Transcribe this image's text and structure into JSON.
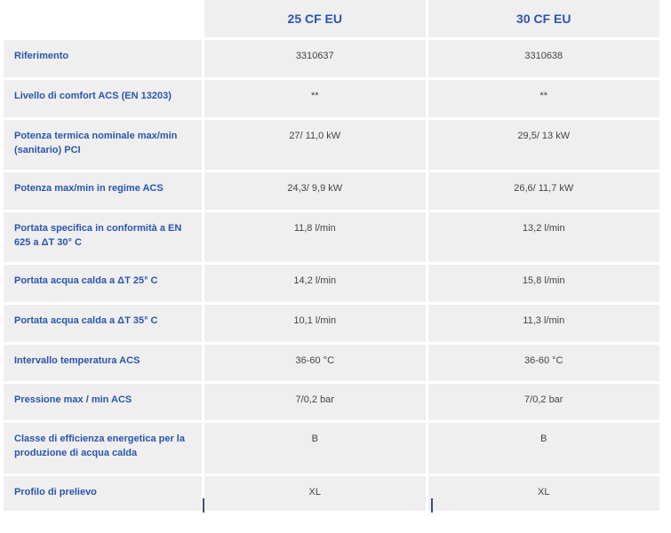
{
  "table": {
    "columns": [
      "25 CF EU",
      "30 CF EU"
    ],
    "rows": [
      {
        "label": "Riferimento",
        "values": [
          "3310637",
          "3310638"
        ]
      },
      {
        "label": "Livello di comfort ACS (EN 13203)",
        "values": [
          "**",
          "**"
        ]
      },
      {
        "label": "Potenza termica nominale max/min (sanitario) PCI",
        "values": [
          "27/ 11,0 kW",
          "29,5/ 13 kW"
        ]
      },
      {
        "label": "Potenza max/min in regime ACS",
        "values": [
          "24,3/ 9,9 kW",
          "26,6/ 11,7 kW"
        ]
      },
      {
        "label": "Portata specifica in conformità a EN 625 a ΔT 30° C",
        "values": [
          "11,8 l/min",
          "13,2 l/min"
        ]
      },
      {
        "label": "Portata acqua calda a ΔT 25° C",
        "values": [
          "14,2 l/min",
          "15,8 l/min"
        ]
      },
      {
        "label": "Portata acqua calda a ΔT 35° C",
        "values": [
          "10,1 l/min",
          "11,3 l/min"
        ]
      },
      {
        "label": "Intervallo temperatura ACS",
        "values": [
          "36-60 °C",
          "36-60 °C"
        ]
      },
      {
        "label": "Pressione max / min ACS",
        "values": [
          "7/0,2 bar",
          "7/0,2 bar"
        ]
      },
      {
        "label": "Classe di efficienza energetica per la produzione di acqua calda",
        "values": [
          "B",
          "B"
        ]
      },
      {
        "label": "Profilo di prelievo",
        "values": [
          "XL",
          "XL"
        ]
      }
    ]
  }
}
